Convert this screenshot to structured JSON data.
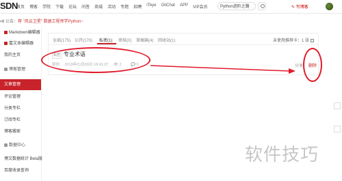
{
  "topbar": {
    "logo": "SDN",
    "nav": [
      "首页",
      "博客",
      "学院",
      "下载",
      "论坛",
      "问答",
      "商城",
      "活动",
      "专题",
      "招聘",
      "ITeye",
      "GitChat",
      "APP",
      "VIP会员"
    ],
    "search_value": "Python进阶之路",
    "write_label": "写博客"
  },
  "notice": {
    "prefix": "公告：",
    "highlight": "荐 \"风云卫星\" 数据工程师学Python~"
  },
  "sidebar": {
    "items": [
      {
        "label": "Markdown编辑器",
        "active": false,
        "icon_color": "#c8222a"
      },
      {
        "label": "富文本编辑器",
        "active": false,
        "icon_color": "#c8222a"
      },
      {
        "label": "我的主页",
        "active": false,
        "icon_color": ""
      },
      {
        "label": "博客管理",
        "active": false,
        "icon_color": "#999999",
        "head": true
      },
      {
        "label": "文章管理",
        "active": true,
        "icon_color": ""
      },
      {
        "label": "评论管理",
        "active": false,
        "icon_color": ""
      },
      {
        "label": "分类专栏",
        "active": false,
        "icon_color": ""
      },
      {
        "label": "订阅专栏",
        "active": false,
        "icon_color": ""
      },
      {
        "label": "博客搬家",
        "active": false,
        "icon_color": ""
      },
      {
        "label": "数据中心",
        "active": false,
        "icon_color": "#999999",
        "head": true
      },
      {
        "label": "博文数据统计 Beta版",
        "active": false,
        "icon_color": ""
      },
      {
        "label": "百度收录查询",
        "active": false,
        "icon_color": ""
      }
    ]
  },
  "tabs": [
    {
      "label": "全部(175)",
      "active": false
    },
    {
      "label": "公开(170)",
      "active": false
    },
    {
      "label": "私密(1)",
      "active": true
    },
    {
      "label": "审核(0)",
      "active": false
    },
    {
      "label": "草稿箱(4)",
      "active": false
    },
    {
      "label": "回收站(1)",
      "active": false
    }
  ],
  "quota": {
    "label": "未使用推荐卡：",
    "count": "1",
    "unit": "张"
  },
  "article": {
    "badge": "私密",
    "title": "专业术语",
    "type": "原创",
    "date": "2019年01月09日 18:41:07",
    "views": "2",
    "comments": "0",
    "manage_label": "分享",
    "delete_label": "删除"
  },
  "watermark": "软件技巧",
  "colors": {
    "accent": "#c8222a",
    "annotation": "#e0192a"
  }
}
